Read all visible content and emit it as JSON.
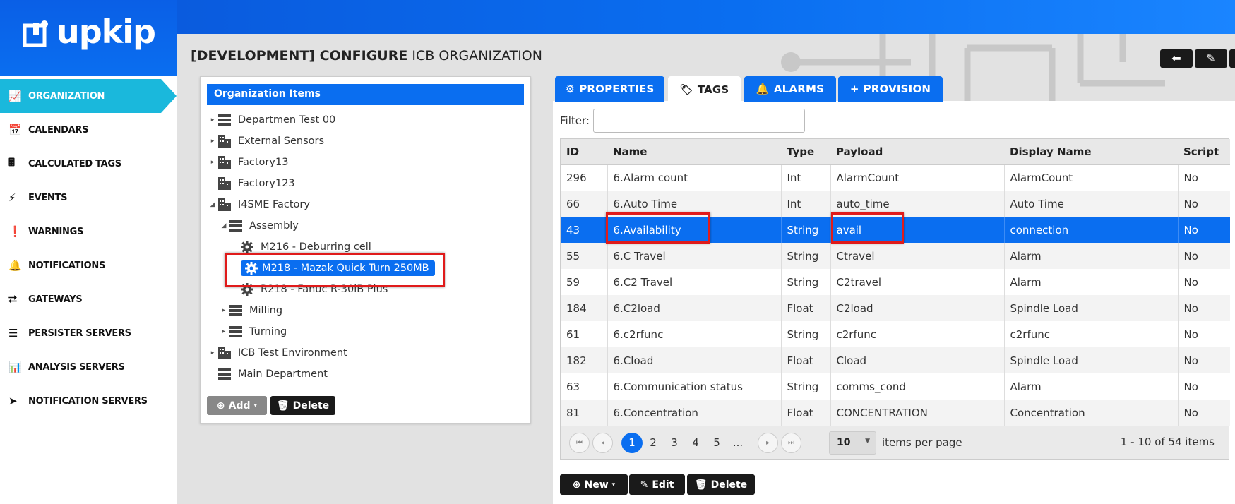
{
  "app": {
    "logo_text": "upkip"
  },
  "sidebar": {
    "items": [
      {
        "label": "ORGANIZATION",
        "icon": "area-chart-icon"
      },
      {
        "label": "CALENDARS",
        "icon": "calendar-icon"
      },
      {
        "label": "CALCULATED TAGS",
        "icon": "calculator-icon"
      },
      {
        "label": "EVENTS",
        "icon": "bolt-icon"
      },
      {
        "label": "WARNINGS",
        "icon": "exclamation-circle-icon"
      },
      {
        "label": "NOTIFICATIONS",
        "icon": "bell-icon"
      },
      {
        "label": "GATEWAYS",
        "icon": "sitemap-icon"
      },
      {
        "label": "PERSISTER SERVERS",
        "icon": "server-icon"
      },
      {
        "label": "ANALYSIS SERVERS",
        "icon": "bar-chart-icon"
      },
      {
        "label": "NOTIFICATION SERVERS",
        "icon": "paper-plane-icon"
      }
    ]
  },
  "header": {
    "title_bold": "[DEVELOPMENT] CONFIGURE",
    "title_rest": "ICB ORGANIZATION",
    "buttons": [
      "back-icon",
      "pencil-icon"
    ]
  },
  "tree": {
    "header": "Organization Items",
    "items": [
      {
        "label": "Departmen Test 00",
        "icon": "server-icon"
      },
      {
        "label": "External Sensors",
        "icon": "building-icon"
      },
      {
        "label": "Factory13",
        "icon": "building-icon"
      },
      {
        "label": "Factory123",
        "icon": "building-icon"
      },
      {
        "label": "I4SME Factory",
        "icon": "building-icon"
      },
      {
        "label": "Assembly",
        "icon": "server-icon"
      },
      {
        "label": "M216 - Deburring cell",
        "icon": "gear-icon"
      },
      {
        "label": "M218 - Mazak Quick Turn 250MB",
        "icon": "gear-icon"
      },
      {
        "label": "R218 - Fanuc R-30iB Plus",
        "icon": "gear-icon"
      },
      {
        "label": "Milling",
        "icon": "server-icon"
      },
      {
        "label": "Turning",
        "icon": "server-icon"
      },
      {
        "label": "ICB Test Environment",
        "icon": "building-icon"
      },
      {
        "label": "Main Department",
        "icon": "server-icon"
      }
    ],
    "add_label": "Add",
    "delete_label": "Delete"
  },
  "tabs": [
    {
      "label": "PROPERTIES",
      "icon": "gear-icon"
    },
    {
      "label": "TAGS",
      "icon": "tag-icon"
    },
    {
      "label": "ALARMS",
      "icon": "bell-icon"
    },
    {
      "label": "PROVISION",
      "icon": "plus-icon"
    }
  ],
  "filter": {
    "label": "Filter:",
    "value": ""
  },
  "grid": {
    "columns": [
      "ID",
      "Name",
      "Type",
      "Payload",
      "Display Name",
      "Script"
    ],
    "rows": [
      [
        "296",
        "6.Alarm count",
        "Int",
        "AlarmCount",
        "AlarmCount",
        "No"
      ],
      [
        "66",
        "6.Auto Time",
        "Int",
        "auto_time",
        "Auto Time",
        "No"
      ],
      [
        "43",
        "6.Availability",
        "String",
        "avail",
        "connection",
        "No"
      ],
      [
        "55",
        "6.C Travel",
        "String",
        "Ctravel",
        "Alarm",
        "No"
      ],
      [
        "59",
        "6.C2 Travel",
        "String",
        "C2travel",
        "Alarm",
        "No"
      ],
      [
        "184",
        "6.C2load",
        "Float",
        "C2load",
        "Spindle Load",
        "No"
      ],
      [
        "61",
        "6.c2rfunc",
        "String",
        "c2rfunc",
        "c2rfunc",
        "No"
      ],
      [
        "182",
        "6.Cload",
        "Float",
        "Cload",
        "Spindle Load",
        "No"
      ],
      [
        "63",
        "6.Communication status",
        "String",
        "comms_cond",
        "Alarm",
        "No"
      ],
      [
        "81",
        "6.Concentration",
        "Float",
        "CONCENTRATION",
        "Concentration",
        "No"
      ]
    ]
  },
  "pager": {
    "pages": [
      "1",
      "2",
      "3",
      "4",
      "5",
      "..."
    ],
    "current": "1",
    "page_size": "10",
    "items_per_page_label": "items per page",
    "range_text": "1 - 10 of 54 items"
  },
  "actions": {
    "new_label": "New",
    "edit_label": "Edit",
    "delete_label": "Delete"
  },
  "colors": {
    "accent": "#0a6ef0",
    "sidebar_active": "#1ab8dc",
    "highlight": "#e01b1b"
  }
}
